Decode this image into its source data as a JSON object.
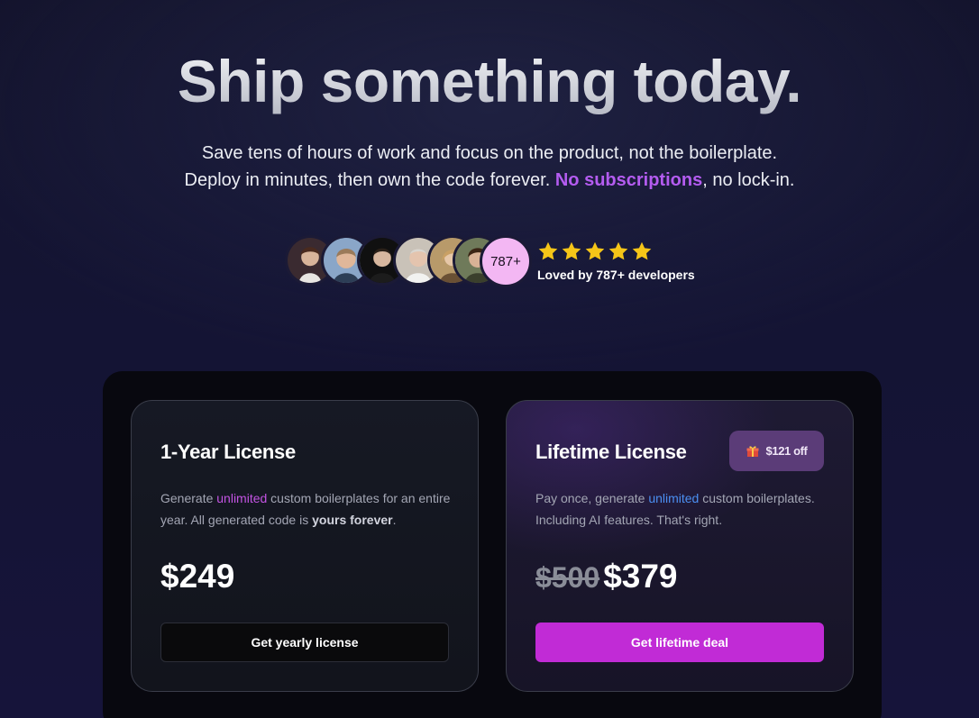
{
  "hero": {
    "title": "Ship something today.",
    "subtitle_line1": "Save tens of hours of work and focus on the product, not the boilerplate.",
    "subtitle_line2_start": "Deploy in minutes, then own the code forever. ",
    "subtitle_line2_accent": "No subscriptions",
    "subtitle_line2_end": ", no lock-in."
  },
  "social_proof": {
    "count_badge": "787+",
    "stars": 5,
    "loved_text": "Loved by 787+ developers",
    "star_color": "#f5c518"
  },
  "plans": [
    {
      "title": "1-Year License",
      "desc_pre": "Generate ",
      "desc_hl": "unlimited",
      "desc_mid": " custom boilerplates for an entire year. All generated code is ",
      "desc_bold": "yours forever",
      "desc_end": ".",
      "price": "$249",
      "button": "Get yearly license"
    },
    {
      "title": "Lifetime License",
      "badge": "$121 off",
      "desc_pre": "Pay once, generate ",
      "desc_hl": "unlimited",
      "desc_end": " custom boilerplates. Including AI features. That's right.",
      "price_old": "$500",
      "price": "$379",
      "button": "Get lifetime deal"
    }
  ],
  "colors": {
    "accent_purple": "#b45cf0",
    "button_lifetime": "#c12bd6",
    "badge_bg": "#5b3c78"
  }
}
